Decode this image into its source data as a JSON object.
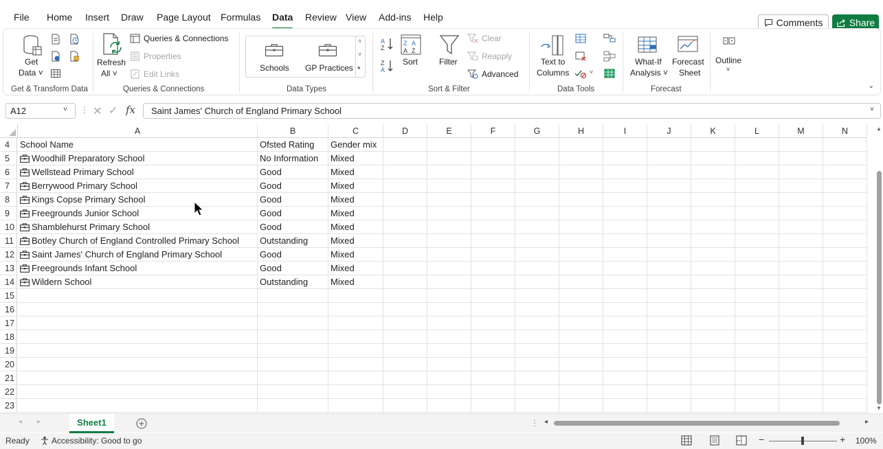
{
  "menu": {
    "tabs": [
      "File",
      "Home",
      "Insert",
      "Draw",
      "Page Layout",
      "Formulas",
      "Data",
      "Review",
      "View",
      "Add-ins",
      "Help"
    ],
    "active": "Data",
    "comments_label": "Comments",
    "share_label": "Share"
  },
  "ribbon": {
    "get_data_line1": "Get",
    "get_data_line2": "Data",
    "refresh_line1": "Refresh",
    "refresh_line2": "All",
    "queries_connections": "Queries & Connections",
    "properties": "Properties",
    "edit_links": "Edit Links",
    "schools": "Schools",
    "gp_practices": "GP Practices",
    "sort": "Sort",
    "filter": "Filter",
    "clear": "Clear",
    "reapply": "Reapply",
    "advanced": "Advanced",
    "text_to_line1": "Text to",
    "text_to_line2": "Columns",
    "whatif_line1": "What-If",
    "whatif_line2": "Analysis",
    "forecast_line1": "Forecast",
    "forecast_line2": "Sheet",
    "outline": "Outline",
    "groups": {
      "get_transform": "Get & Transform Data",
      "queries": "Queries & Connections",
      "data_types": "Data Types",
      "sort_filter": "Sort & Filter",
      "data_tools": "Data Tools",
      "forecast": "Forecast"
    }
  },
  "formula_bar": {
    "name_box": "A12",
    "fx": "fx",
    "formula": "Saint James' Church of England Primary School"
  },
  "grid": {
    "columns": [
      "A",
      "B",
      "C",
      "D",
      "E",
      "F",
      "G",
      "H",
      "I",
      "J",
      "K",
      "L",
      "M",
      "N"
    ],
    "row_numbers": [
      "4",
      "5",
      "6",
      "7",
      "8",
      "9",
      "10",
      "11",
      "12",
      "13",
      "14",
      "15",
      "16",
      "17",
      "18",
      "19",
      "20",
      "21",
      "22",
      "23"
    ],
    "header": {
      "a": "School Name",
      "b": "Ofsted Rating",
      "c": "Gender mix"
    },
    "rows": [
      {
        "a": "Woodhill Preparatory School",
        "b": "No Information",
        "c": "Mixed"
      },
      {
        "a": "Wellstead Primary School",
        "b": "Good",
        "c": "Mixed"
      },
      {
        "a": "Berrywood Primary School",
        "b": "Good",
        "c": "Mixed"
      },
      {
        "a": "Kings Copse Primary School",
        "b": "Good",
        "c": "Mixed"
      },
      {
        "a": "Freegrounds Junior School",
        "b": "Good",
        "c": "Mixed"
      },
      {
        "a": "Shamblehurst Primary School",
        "b": "Good",
        "c": "Mixed"
      },
      {
        "a": "Botley Church of England Controlled Primary School",
        "b": "Outstanding",
        "c": "Mixed"
      },
      {
        "a": "Saint James' Church of England Primary School",
        "b": "Good",
        "c": "Mixed"
      },
      {
        "a": "Freegrounds Infant School",
        "b": "Good",
        "c": "Mixed"
      },
      {
        "a": "Wildern School",
        "b": "Outstanding",
        "c": "Mixed"
      }
    ]
  },
  "sheet_tabs": {
    "active": "Sheet1"
  },
  "status": {
    "ready": "Ready",
    "accessibility": "Accessibility: Good to go",
    "zoom": "100%"
  },
  "colors": {
    "accent": "#107c41",
    "data_type_icon": "#333333"
  }
}
